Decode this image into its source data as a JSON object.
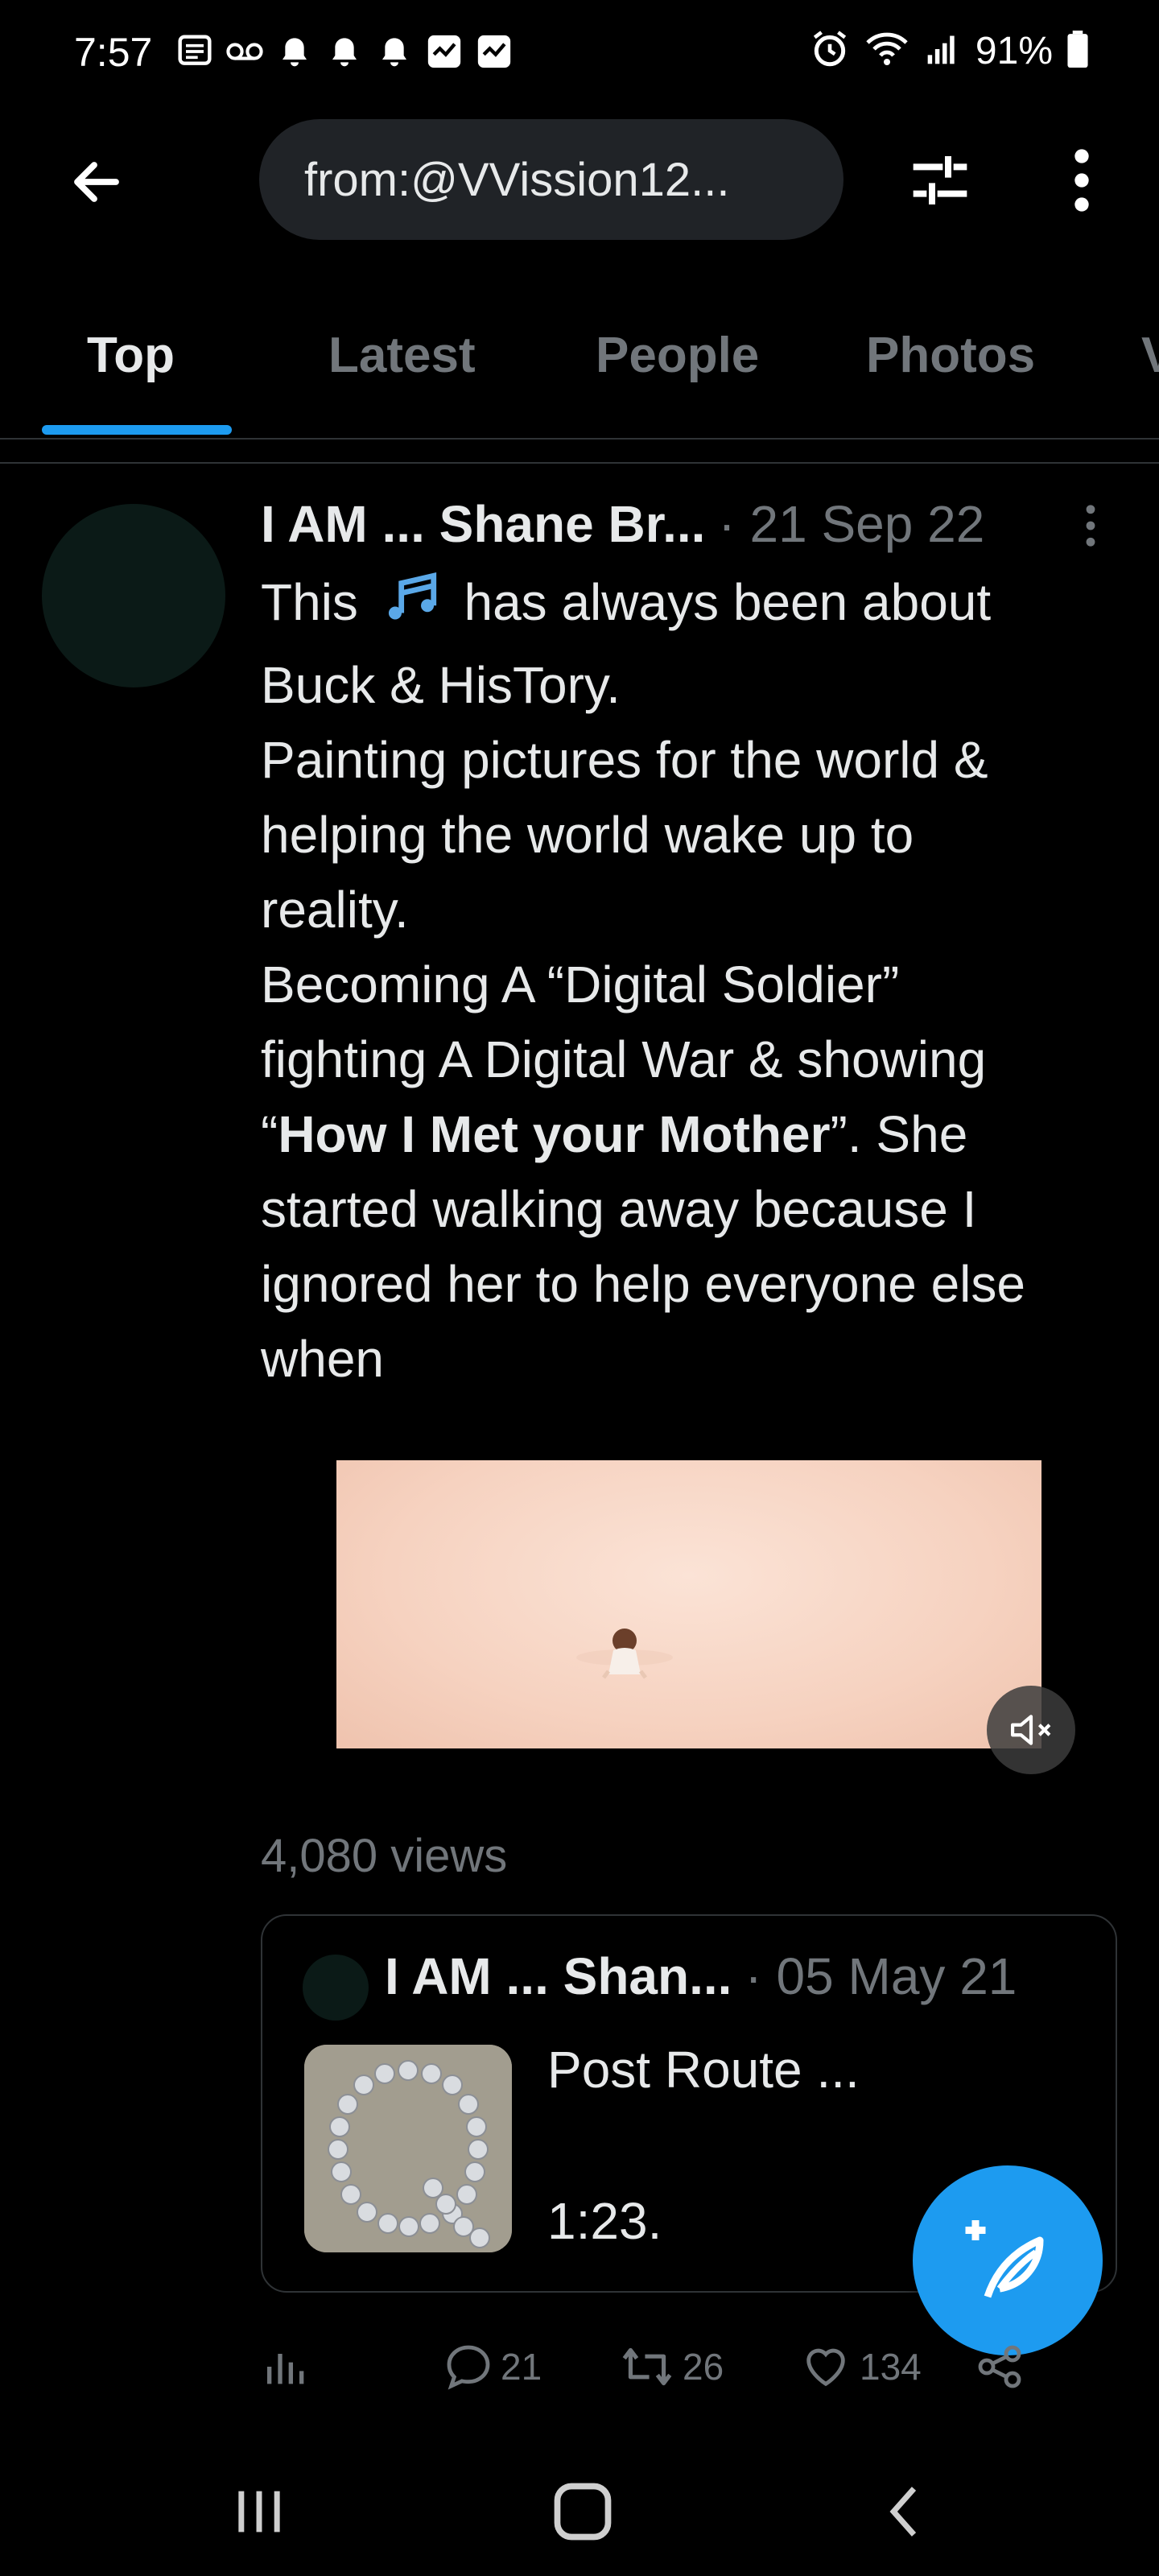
{
  "status_bar": {
    "time": "7:57",
    "battery": "91%",
    "notification_icons": [
      "message-icon",
      "voicemail-icon",
      "bell-icon",
      "bell-icon",
      "bell-icon",
      "check-app-icon",
      "check-app-icon"
    ]
  },
  "search": {
    "query": "from:@VVission12..."
  },
  "tabs": [
    "Top",
    "Latest",
    "People",
    "Photos",
    "V"
  ],
  "tweet": {
    "author": "I AM ... Shane Br...",
    "date": "· 21 Sep 22",
    "body_line1_a": "This ",
    "body_line1_b": " has always been about",
    "body_rest_1": "Buck & HisTory.",
    "body_rest_2": "Painting pictures for the world &",
    "body_rest_3": "helping the world wake up to",
    "body_rest_4": "reality.",
    "body_rest_5": "Becoming A “Digital Soldier”",
    "body_rest_6": "fighting A Digital War & showing",
    "body_quote_open": "“",
    "body_bold": "How I Met your Mother",
    "body_quote_close": "”. She",
    "body_rest_7": "started walking away because I",
    "body_rest_8": "ignored her to help everyone else",
    "body_rest_9": "when",
    "views": "4,080 views"
  },
  "quoted_tweet": {
    "author": "I AM ... Shan...",
    "date": "· 05 May 21",
    "text": "Post Route ...\n\n1:23."
  },
  "actions": {
    "replies": "21",
    "retweets": "26",
    "likes": "134"
  },
  "colors": {
    "accent": "#1d9bf0",
    "background": "#000000",
    "muted": "#71767b"
  }
}
